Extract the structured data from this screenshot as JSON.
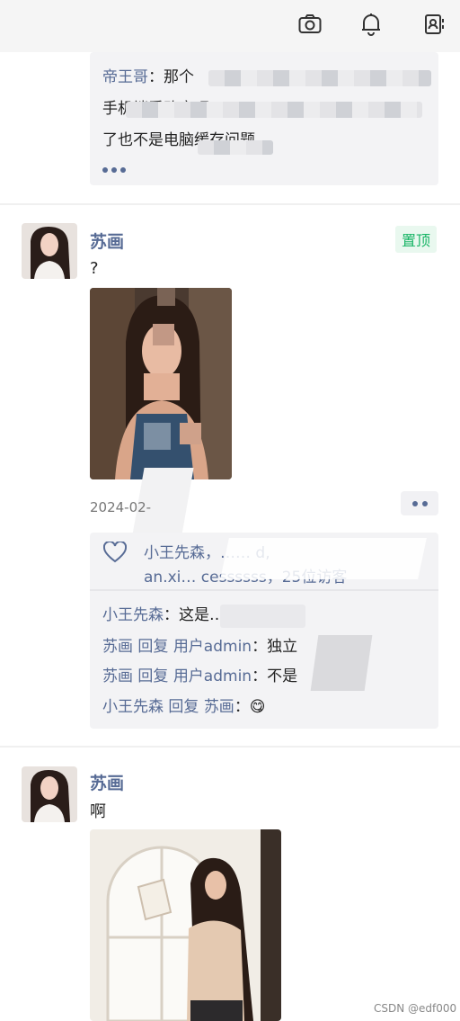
{
  "first_post": {
    "comment_author": "帝王哥",
    "comment_colon": "：",
    "comment_text_start": "那个",
    "comment_line2": "手机端看改变吧",
    "comment_line3": "了也不是电脑缓存问题"
  },
  "post2": {
    "author": "苏画",
    "badge": "置顶",
    "content": "?",
    "date": "2024-02-",
    "likes_line1": "小王先森，…… d,",
    "likes_line2": "an.xi… cessssss，25位访客",
    "comments": [
      {
        "author": "小王先森",
        "text": "：这是…"
      },
      {
        "author": "苏画",
        "reply_word": "回复",
        "target": "用户admin",
        "text": "：独立"
      },
      {
        "author": "苏画",
        "reply_word": "回复",
        "target": "用户admin",
        "text": "：不是"
      },
      {
        "author": "小王先森",
        "reply_word": "回复",
        "target": "苏画",
        "text": "：😋"
      }
    ]
  },
  "post3": {
    "author": "苏画",
    "content": "啊"
  },
  "watermark": "CSDN @edf000",
  "colors": {
    "link": "#576b95",
    "pin": "#18b566",
    "panel": "#f3f3f5"
  }
}
